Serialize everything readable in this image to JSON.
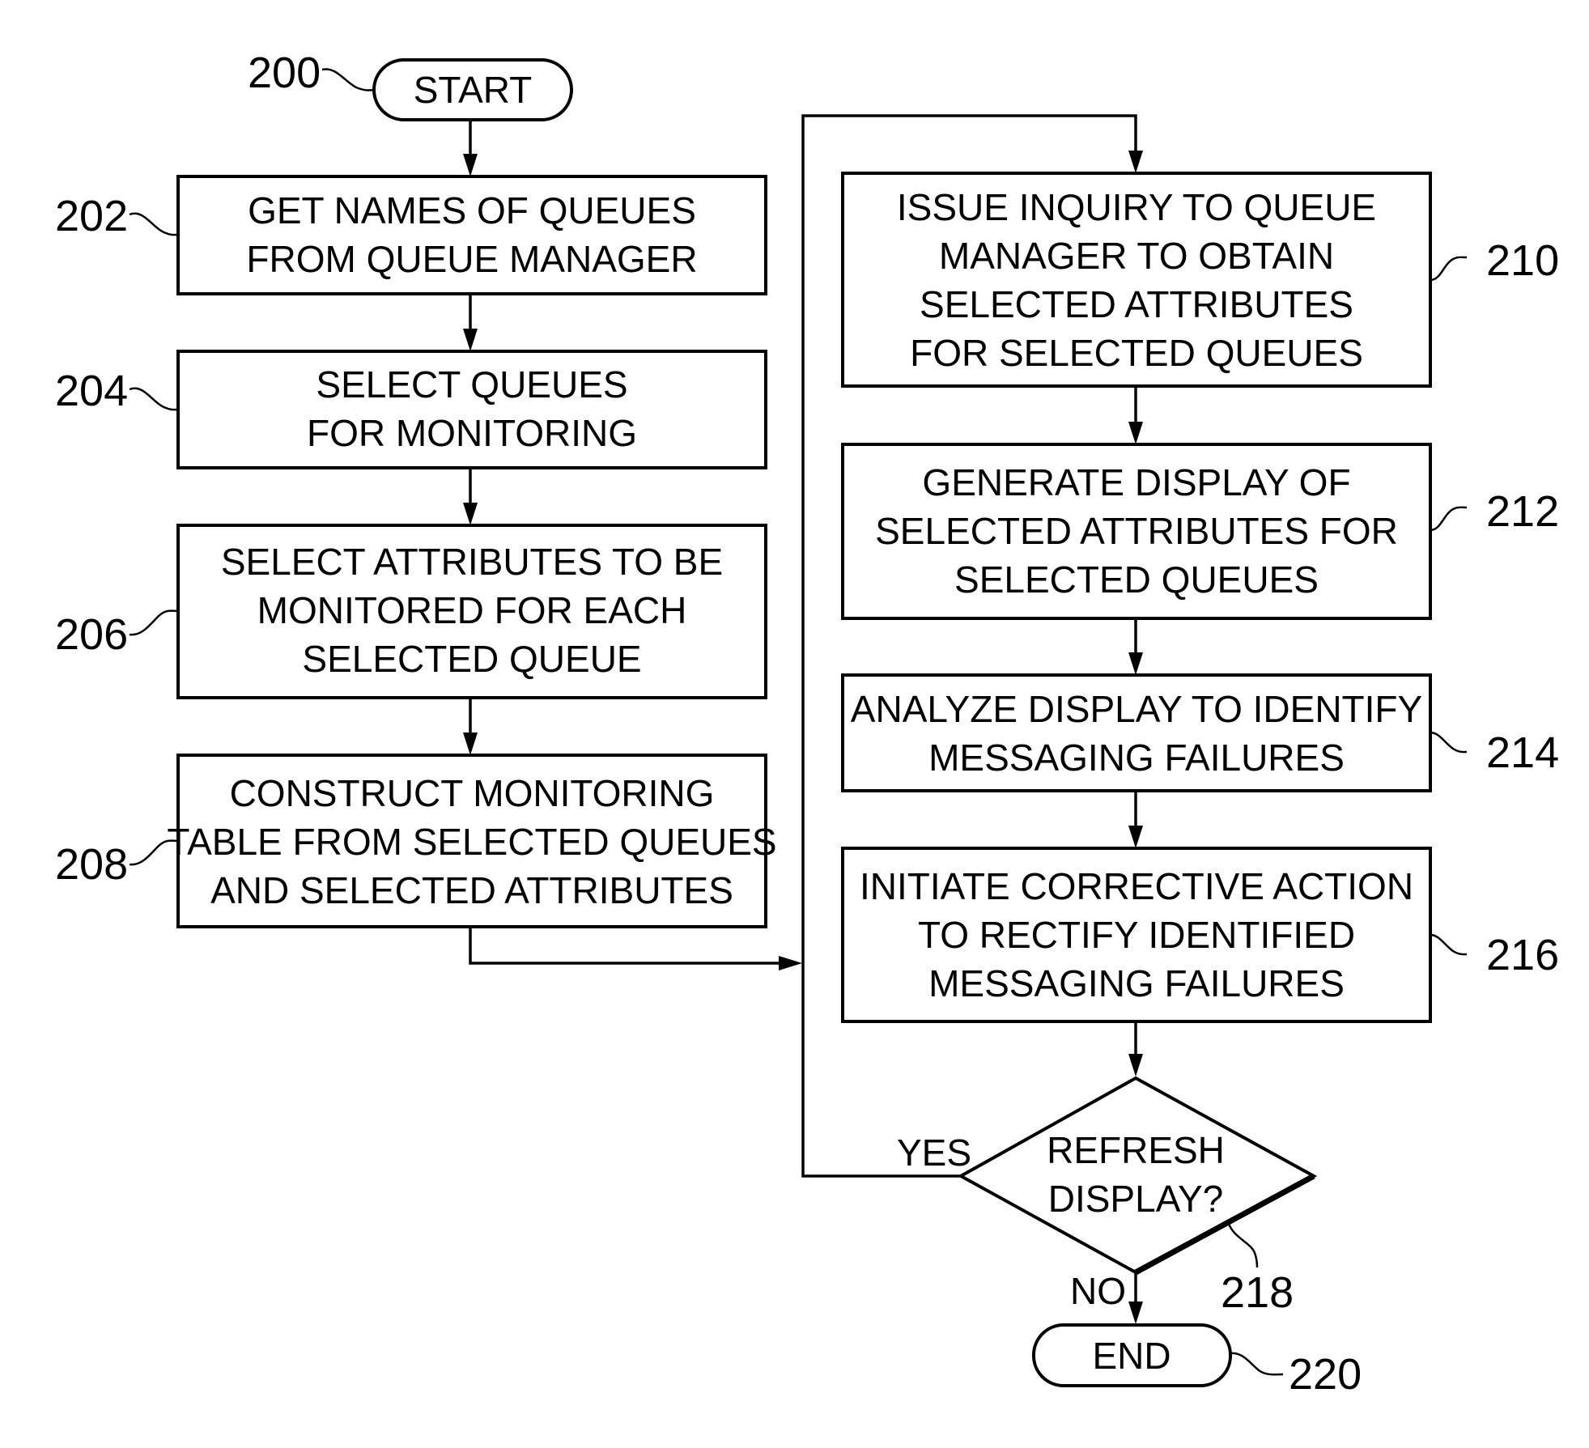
{
  "figure": {
    "start": {
      "ref": "200",
      "label": "START"
    },
    "end": {
      "ref": "220",
      "label": "END"
    },
    "steps": [
      {
        "ref": "202",
        "lines": [
          "GET NAMES OF QUEUES",
          "FROM QUEUE MANAGER"
        ]
      },
      {
        "ref": "204",
        "lines": [
          "SELECT QUEUES",
          "FOR MONITORING"
        ]
      },
      {
        "ref": "206",
        "lines": [
          "SELECT ATTRIBUTES TO BE",
          "MONITORED FOR EACH",
          "SELECTED QUEUE"
        ]
      },
      {
        "ref": "208",
        "lines": [
          "CONSTRUCT MONITORING",
          "TABLE FROM SELECTED QUEUES",
          "AND SELECTED ATTRIBUTES"
        ]
      },
      {
        "ref": "210",
        "lines": [
          "ISSUE INQUIRY TO QUEUE",
          "MANAGER TO OBTAIN",
          "SELECTED ATTRIBUTES",
          "FOR SELECTED QUEUES"
        ]
      },
      {
        "ref": "212",
        "lines": [
          "GENERATE DISPLAY OF",
          "SELECTED ATTRIBUTES FOR",
          "SELECTED QUEUES"
        ]
      },
      {
        "ref": "214",
        "lines": [
          "ANALYZE DISPLAY TO IDENTIFY",
          "MESSAGING FAILURES"
        ]
      },
      {
        "ref": "216",
        "lines": [
          "INITIATE CORRECTIVE ACTION",
          "TO RECTIFY IDENTIFIED",
          "MESSAGING FAILURES"
        ]
      }
    ],
    "decision": {
      "ref": "218",
      "lines": [
        "REFRESH",
        "DISPLAY?"
      ],
      "yes_label": "YES",
      "no_label": "NO"
    }
  }
}
